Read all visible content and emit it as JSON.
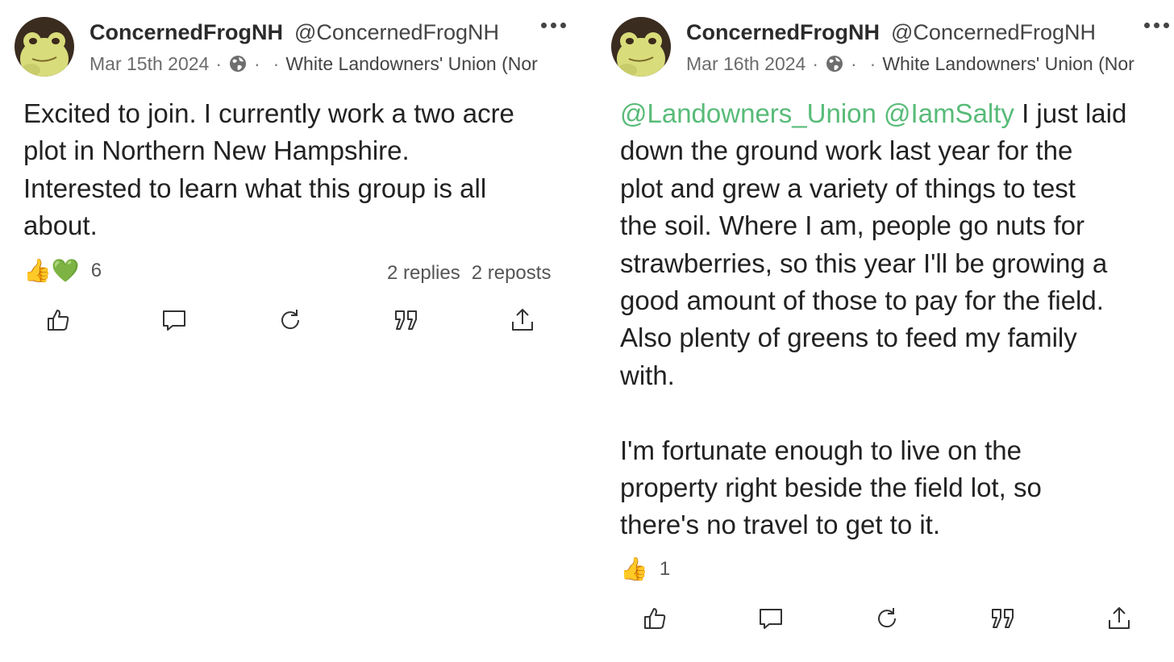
{
  "posts": [
    {
      "display_name": "ConcernedFrogNH",
      "handle": "@ConcernedFrogNH",
      "date": "Mar 15th 2024",
      "group": "White Landowners' Union (Nor",
      "text": "Excited to join. I currently work a two acre\nplot in Northern New Hampshire.\nInterested to learn what this group is all\nabout.",
      "reaction_emoji": "👍💚",
      "reaction_count": "6",
      "replies": "2 replies",
      "reposts": "2 reposts"
    },
    {
      "display_name": "ConcernedFrogNH",
      "handle": "@ConcernedFrogNH",
      "date": "Mar 16th 2024",
      "group": "White Landowners' Union (Nor",
      "mention1": "@Landowners_Union",
      "mention2": "@IamSalty",
      "text_first": " I just laid\ndown the ground work last year for the\nplot and grew a variety of things to test\nthe soil. Where I am, people go nuts for\nstrawberries, so this year I'll be growing a\ngood amount of those to pay for the field.\nAlso plenty of greens to feed my family\nwith.\n\nI'm fortunate enough to live on the\nproperty right beside the field lot, so\nthere's no travel to get to it.",
      "reaction_emoji": "👍",
      "reaction_count": "1"
    }
  ],
  "icons": {
    "globe": "globe-icon",
    "like": "thumbs-up-icon",
    "comment": "comment-icon",
    "repost": "repost-icon",
    "quote": "quote-icon",
    "share": "share-icon",
    "more": "more-icon"
  },
  "colors": {
    "mention": "#58bb78",
    "text": "#222222",
    "meta": "#6b6b6b"
  }
}
